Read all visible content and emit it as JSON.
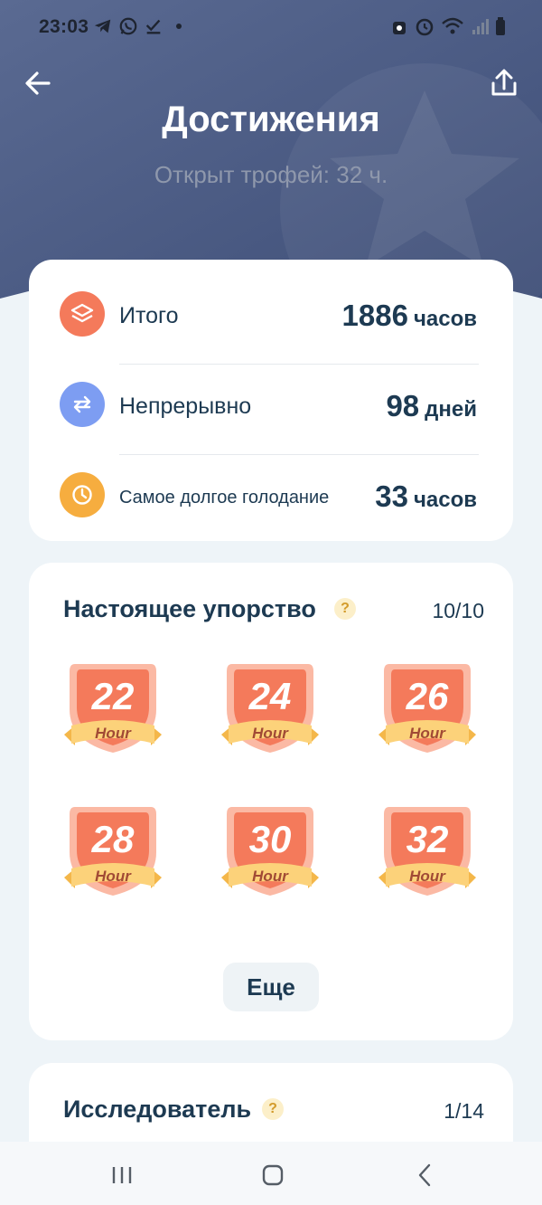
{
  "status_bar": {
    "time": "23:03"
  },
  "header": {
    "title": "Достижения",
    "subtitle": "Открыт трофей: 32 ч."
  },
  "stats": [
    {
      "label": "Итого",
      "value": "1886",
      "unit": "часов",
      "icon": "layers-icon",
      "color": "#f47a5b"
    },
    {
      "label": "Непрерывно",
      "value": "98",
      "unit": "дней",
      "icon": "repeat-icon",
      "color": "#7d9df2"
    },
    {
      "label": "Самое долгое голодание",
      "value": "33",
      "unit": "часов",
      "icon": "clock-icon",
      "color": "#f6ad3f"
    }
  ],
  "achievements": {
    "title": "Настоящее упорство",
    "count": "10/10",
    "help": "?",
    "badges": [
      {
        "number": "22",
        "unit": "Hour"
      },
      {
        "number": "24",
        "unit": "Hour"
      },
      {
        "number": "26",
        "unit": "Hour"
      },
      {
        "number": "28",
        "unit": "Hour"
      },
      {
        "number": "30",
        "unit": "Hour"
      },
      {
        "number": "32",
        "unit": "Hour"
      }
    ],
    "more_label": "Еще"
  },
  "explorer": {
    "title": "Исследователь",
    "count": "1/14",
    "help": "?"
  },
  "colors": {
    "header_bg": "#4a5b85",
    "badge_fill": "#f47a5b",
    "ribbon": "#fcd27a",
    "text_dark": "#1d3a52"
  }
}
